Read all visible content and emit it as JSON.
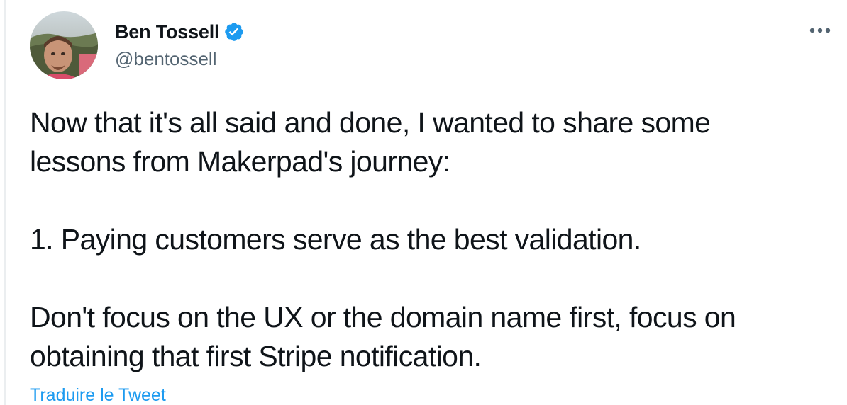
{
  "author": {
    "display_name": "Ben Tossell",
    "handle": "@bentossell",
    "verified": true,
    "avatar_icon": "avatar-photo"
  },
  "menu": {
    "more_icon": "more-horizontal-icon"
  },
  "tweet": {
    "text": "Now that it's all said and done, I wanted to share some\nlessons from Makerpad's journey:\n\n1. Paying customers serve as the best validation.\n\nDon't focus on the UX or the domain name first, focus on\nobtaining that first Stripe notification.",
    "translate_label": "Traduire le Tweet"
  },
  "colors": {
    "text_primary": "#0f1419",
    "text_secondary": "#536471",
    "accent": "#1d9bf0"
  }
}
